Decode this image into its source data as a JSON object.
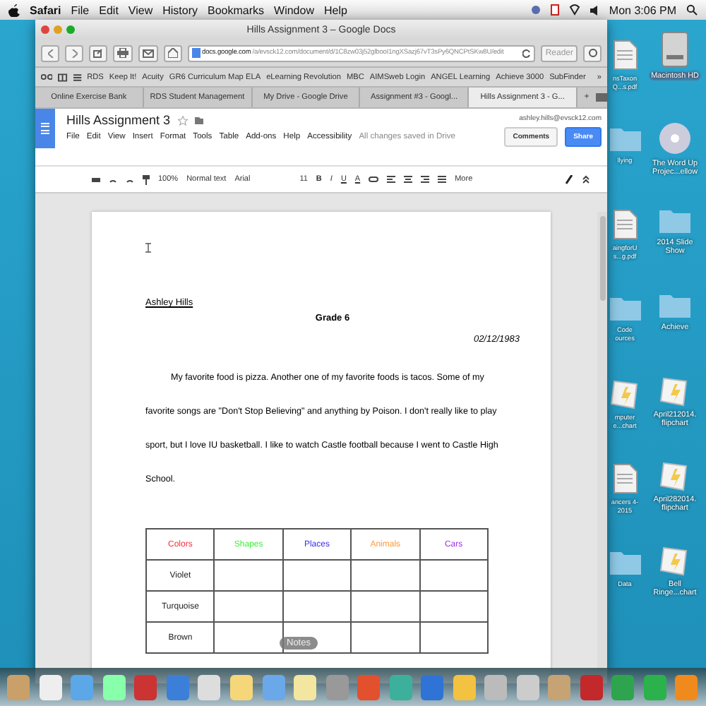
{
  "menu_bar": {
    "app": "Safari",
    "menus": [
      "File",
      "Edit",
      "View",
      "History",
      "Bookmarks",
      "Window",
      "Help"
    ],
    "clock": "Mon 3:06 PM"
  },
  "browser": {
    "title": "Hills Assignment 3 – Google Docs",
    "url_host": "docs.google.com",
    "url_path": "/a/evsck12.com/document/d/1C8zw03j52glbooI1ngXSazj67vT3sPy6QNCPtSKw8U/edit",
    "reader": "Reader",
    "bookmarks": [
      "RDS",
      "Keep It!",
      "Acuity",
      "GR6 Curriculum Map ELA",
      "eLearning Revolution",
      "MBC",
      "AIMSweb Login",
      "ANGEL Learning",
      "Achieve 3000",
      "SubFinder"
    ],
    "bookmarks_more": "»",
    "tabs": [
      {
        "label": "Online Exercise Bank",
        "selected": false
      },
      {
        "label": "RDS Student Management",
        "selected": false
      },
      {
        "label": "My Drive - Google Drive",
        "selected": false
      },
      {
        "label": "Assignment #3 - Googl...",
        "selected": false
      },
      {
        "label": "Hills Assignment 3 - G...",
        "selected": true
      }
    ],
    "new_tab": "+"
  },
  "doc": {
    "title": "Hills Assignment 3",
    "user": "ashley.hills@evsck12.com",
    "menus": [
      "File",
      "Edit",
      "View",
      "Insert",
      "Format",
      "Tools",
      "Table",
      "Add-ons",
      "Help",
      "Accessibility"
    ],
    "save_status": "All changes saved in Drive",
    "comments": "Comments",
    "share": "Share",
    "toolbar": {
      "zoom": "100%",
      "style": "Normal text",
      "font": "Arial",
      "size": "11",
      "format": [
        "B",
        "I",
        "U",
        "A"
      ],
      "more": "More"
    },
    "page": {
      "name": "Ashley Hills",
      "grade": "Grade 6",
      "date": "02/12/1983",
      "paragraph": "My favorite food is pizza. Another one of my favorite foods is tacos. Some of my favorite songs are \"Don't Stop Believing\" and anything by Poison. I don't really like to play sport, but I love IU basketball. I like to watch Castle football because I went to Castle High School.",
      "table": {
        "columns": [
          {
            "label": "Colors",
            "color": "#ff2a3a"
          },
          {
            "label": "Shapes",
            "color": "#3cf03c"
          },
          {
            "label": "Places",
            "color": "#3b2ee8"
          },
          {
            "label": "Animals",
            "color": "#ff9a3a"
          },
          {
            "label": "Cars",
            "color": "#a02ee8"
          }
        ],
        "rows": [
          "Violet",
          "Turquoise",
          "Brown"
        ]
      }
    }
  },
  "desktop": {
    "partial_icons": [
      {
        "label": "nsTaxon Q...s.pdf",
        "kind": "document"
      },
      {
        "label": "llying",
        "kind": "folder"
      },
      {
        "label": "aingforU s...g.pdf",
        "kind": "document"
      },
      {
        "label": "Code ources",
        "kind": "folder"
      },
      {
        "label": "mputer e...chart",
        "kind": "flipchart"
      },
      {
        "label": "ancers 4-2015",
        "kind": "document"
      },
      {
        "label": "Data",
        "kind": "folder"
      }
    ],
    "icons": [
      {
        "label": "Macintosh HD",
        "kind": "disk"
      },
      {
        "label": "The Word Up Projec...ellow",
        "kind": "disc"
      },
      {
        "label": "2014 Slide Show",
        "kind": "folder"
      },
      {
        "label": "Achieve",
        "kind": "folder"
      },
      {
        "label": "April212014. flipchart",
        "kind": "flipchart"
      },
      {
        "label": "April282014. flipchart",
        "kind": "flipchart"
      },
      {
        "label": "Bell Ringe...chart",
        "kind": "flipchart"
      }
    ]
  },
  "dock": {
    "tooltip": "Notes"
  }
}
